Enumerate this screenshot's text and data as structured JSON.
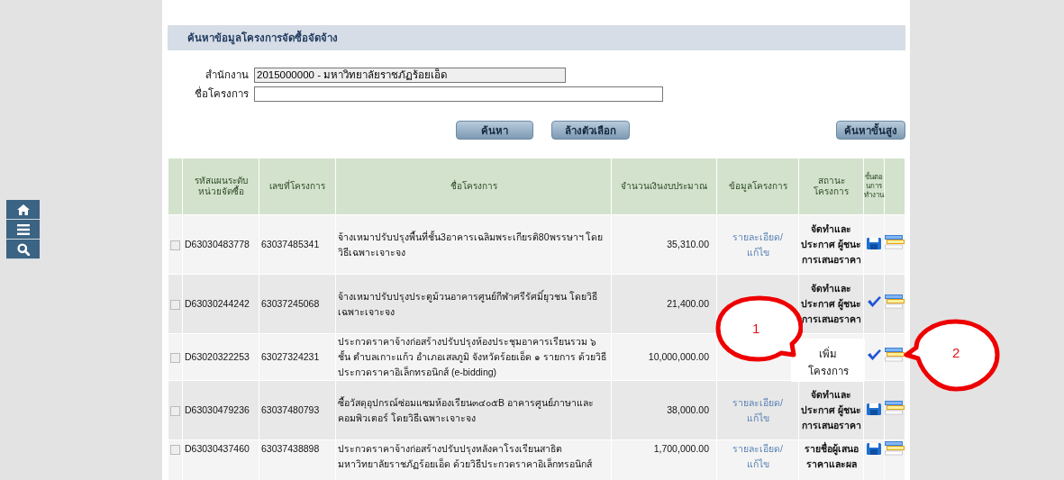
{
  "sidebar": {
    "buttons": [
      {
        "kind": "home"
      },
      {
        "kind": "menu"
      },
      {
        "kind": "search"
      }
    ]
  },
  "search_panel": {
    "title": "ค้นหาข้อมูลโครงการจัดซื้อจัดจ้าง",
    "fields": [
      {
        "label": "สำนักงาน",
        "value": "2015000000 - มหาวิทยาลัยราชภัฏร้อยเอ็ด",
        "disabled": true
      },
      {
        "label": "ชื่อโครงการ",
        "disabled": false
      }
    ],
    "buttons": [
      "ค้นหา",
      "ล้างตัวเลือก"
    ],
    "advanced_button": "ค้นหาขั้นสูง"
  },
  "table": {
    "columns": [
      "รหัสแผนระดับหน่วยจัดซื้อ",
      "เลขที่โครงการ",
      "ชื่อโครงการ",
      "จำนวนเงินงบประมาณ",
      "ข้อมูลโครงการ",
      "สถานะโครงการ",
      "ขั้นตอนการทำงาน"
    ],
    "rows": [
      {
        "checked": false,
        "plan_code": "D63030483778",
        "project_no": "63037485341",
        "name": "จ้างเหมาปรับปรุงพื้นที่ชั้น3อาคารเฉลิมพระเกียรติ80พรรษาฯ โดยวิธีเฉพาะเจาะจง",
        "amount": "35,310.00",
        "detail_link": "รายละเอียด/แก้ไข",
        "status": "จัดทำและประกาศ ผู้ชนะการเสนอราคา",
        "actions": [
          {
            "kind": "save"
          },
          {
            "kind": "list"
          }
        ]
      },
      {
        "checked": false,
        "plan_code": "D63030244242",
        "project_no": "63037245068",
        "name": "จ้างเหมาปรับปรุงประตูม้วนอาคารศูนย์กีฬาศรีรัศมิ์ยุวชน โดยวิธีเฉพาะเจาะจง",
        "amount": "21,400.00",
        "status": "จัดทำและประกาศ ผู้ชนะการเสนอราคา",
        "actions": [
          {
            "kind": "check"
          },
          {
            "kind": "list"
          }
        ]
      },
      {
        "checked": false,
        "plan_code": "D63020322253",
        "project_no": "63027324231",
        "name": "ประกวดราคาจ้างก่อสร้างปรับปรุงห้องประชุมอาคารเรียนรวม ๖ ชั้น ตำบลเกาะแก้ว อำเภอเสลภูมิ จังหวัดร้อยเอ็ด ๑ รายการ ด้วยวิธีประกวดราคาอิเล็กทรอนิกส์ (e-bidding)",
        "amount": "10,000,000.00",
        "tooltip": [
          "เพิ่ม",
          "โครงการ"
        ],
        "actions": [
          {
            "kind": "check"
          },
          {
            "kind": "list"
          }
        ]
      },
      {
        "checked": false,
        "plan_code": "D63030479236",
        "project_no": "63037480793",
        "name": "ซื้อวัสดุอุปกรณ์ซ่อมแซมห้องเรียน๓๔๐๕B อาคารศูนย์ภาษาและคอมพิวเตอร์ โดยวิธีเฉพาะเจาะจง",
        "amount": "38,000.00",
        "detail_link": "รายละเอียด/แก้ไข",
        "status": "จัดทำและประกาศ ผู้ชนะการเสนอราคา",
        "actions": [
          {
            "kind": "save"
          },
          {
            "kind": "list"
          }
        ]
      },
      {
        "checked": false,
        "plan_code": "D63030437460",
        "project_no": "63037438898",
        "name": "ประกวดราคาจ้างก่อสร้างปรับปรุงหลังคาโรงเรียนสาธิตมหาวิทยาลัยราชภัฏร้อยเอ็ด ด้วยวิธีประกวดราคาอิเล็กทรอนิกส์",
        "amount": "1,700,000.00",
        "detail_link": "รายละเอียด/แก้ไข",
        "status": "รายชื่อผู้เสนอราคาและผล",
        "actions": [
          {
            "kind": "save"
          },
          {
            "kind": "list"
          }
        ]
      }
    ]
  },
  "callouts": [
    {
      "label": "1",
      "kind": "tail_right"
    },
    {
      "label": "2",
      "kind": "tail_left"
    }
  ]
}
